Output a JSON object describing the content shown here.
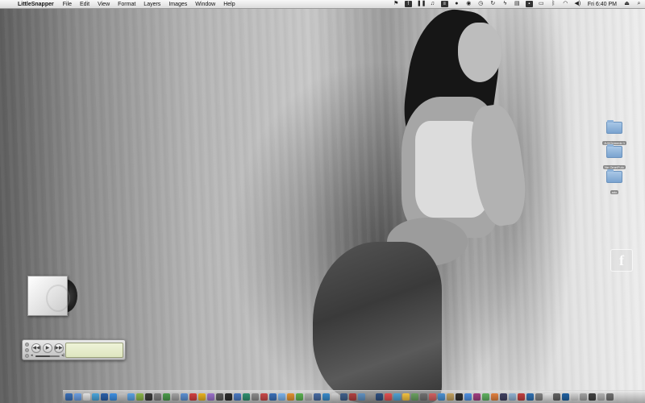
{
  "menubar": {
    "apple_icon": "",
    "app_name": "LittleSnapper",
    "menus": [
      "File",
      "Edit",
      "View",
      "Format",
      "Layers",
      "Images",
      "Window",
      "Help"
    ],
    "status_icons": [
      "stamp-icon",
      "facebook-icon",
      "pause-icon",
      "music-note-icon",
      "stack-icon",
      "chat-icon",
      "eye-icon",
      "time-machine-icon",
      "sync-icon",
      "bolt-icon",
      "clipboard-icon",
      "screen-icon",
      "display-icon",
      "bluetooth-icon",
      "wifi-icon",
      "volume-icon"
    ],
    "clock": "Fri 6:40 PM",
    "eject_icon": "⏏",
    "spotlight_icon": "⌕"
  },
  "desktop_icons": [
    {
      "label": "JUXOnmedo 1"
    },
    {
      "label": "Ne Ome/Fulo"
    },
    {
      "label": "ado"
    }
  ],
  "fb_widget": {
    "glyph": "f"
  },
  "mini_player": {
    "prev": "◀◀",
    "play": "▶",
    "next": "▶▶",
    "lcd_logo": "",
    "volume": 0.6
  },
  "colors": {
    "folder_blue": "#7aa3cf",
    "dock_icons": [
      "#3b6fb6",
      "#6a9de0",
      "#e0e0e0",
      "#4aa3d8",
      "#2a5fa8",
      "#3d8ee0",
      "#c0c0c0",
      "#5aa0e0",
      "#8ab44a",
      "#3a3a3a",
      "#7e7e7e",
      "#4a9a4a",
      "#a0a0a0",
      "#5b8fd0",
      "#d04040",
      "#e6b020",
      "#9a70c8",
      "#5a5a5a",
      "#2c2c2c",
      "#4a78c0",
      "#2f8f6f",
      "#8a8a8a",
      "#c84848",
      "#3b6fb6",
      "#7ab0e8",
      "#e09030",
      "#5ab050",
      "#b0b0b0",
      "#486aa0",
      "#3a8ac8",
      "#d0d0d0",
      "#405f8a",
      "#b04040",
      "#6090c0",
      "#999999",
      "#2f4f7f",
      "#e05050",
      "#50a0d0",
      "#f0c040",
      "#6aa060",
      "#707070",
      "#d06060",
      "#4a90d0",
      "#c0a060",
      "#303030",
      "#5090e0",
      "#a04080",
      "#60b060",
      "#e08040",
      "#404060",
      "#90b0d0",
      "#c04040",
      "#3070b0",
      "#808080",
      "#e0e0e0",
      "#606060",
      "#2060a0",
      "#d0d0d0",
      "#a0a0a0",
      "#404040",
      "#b0b0b0",
      "#707070"
    ]
  }
}
